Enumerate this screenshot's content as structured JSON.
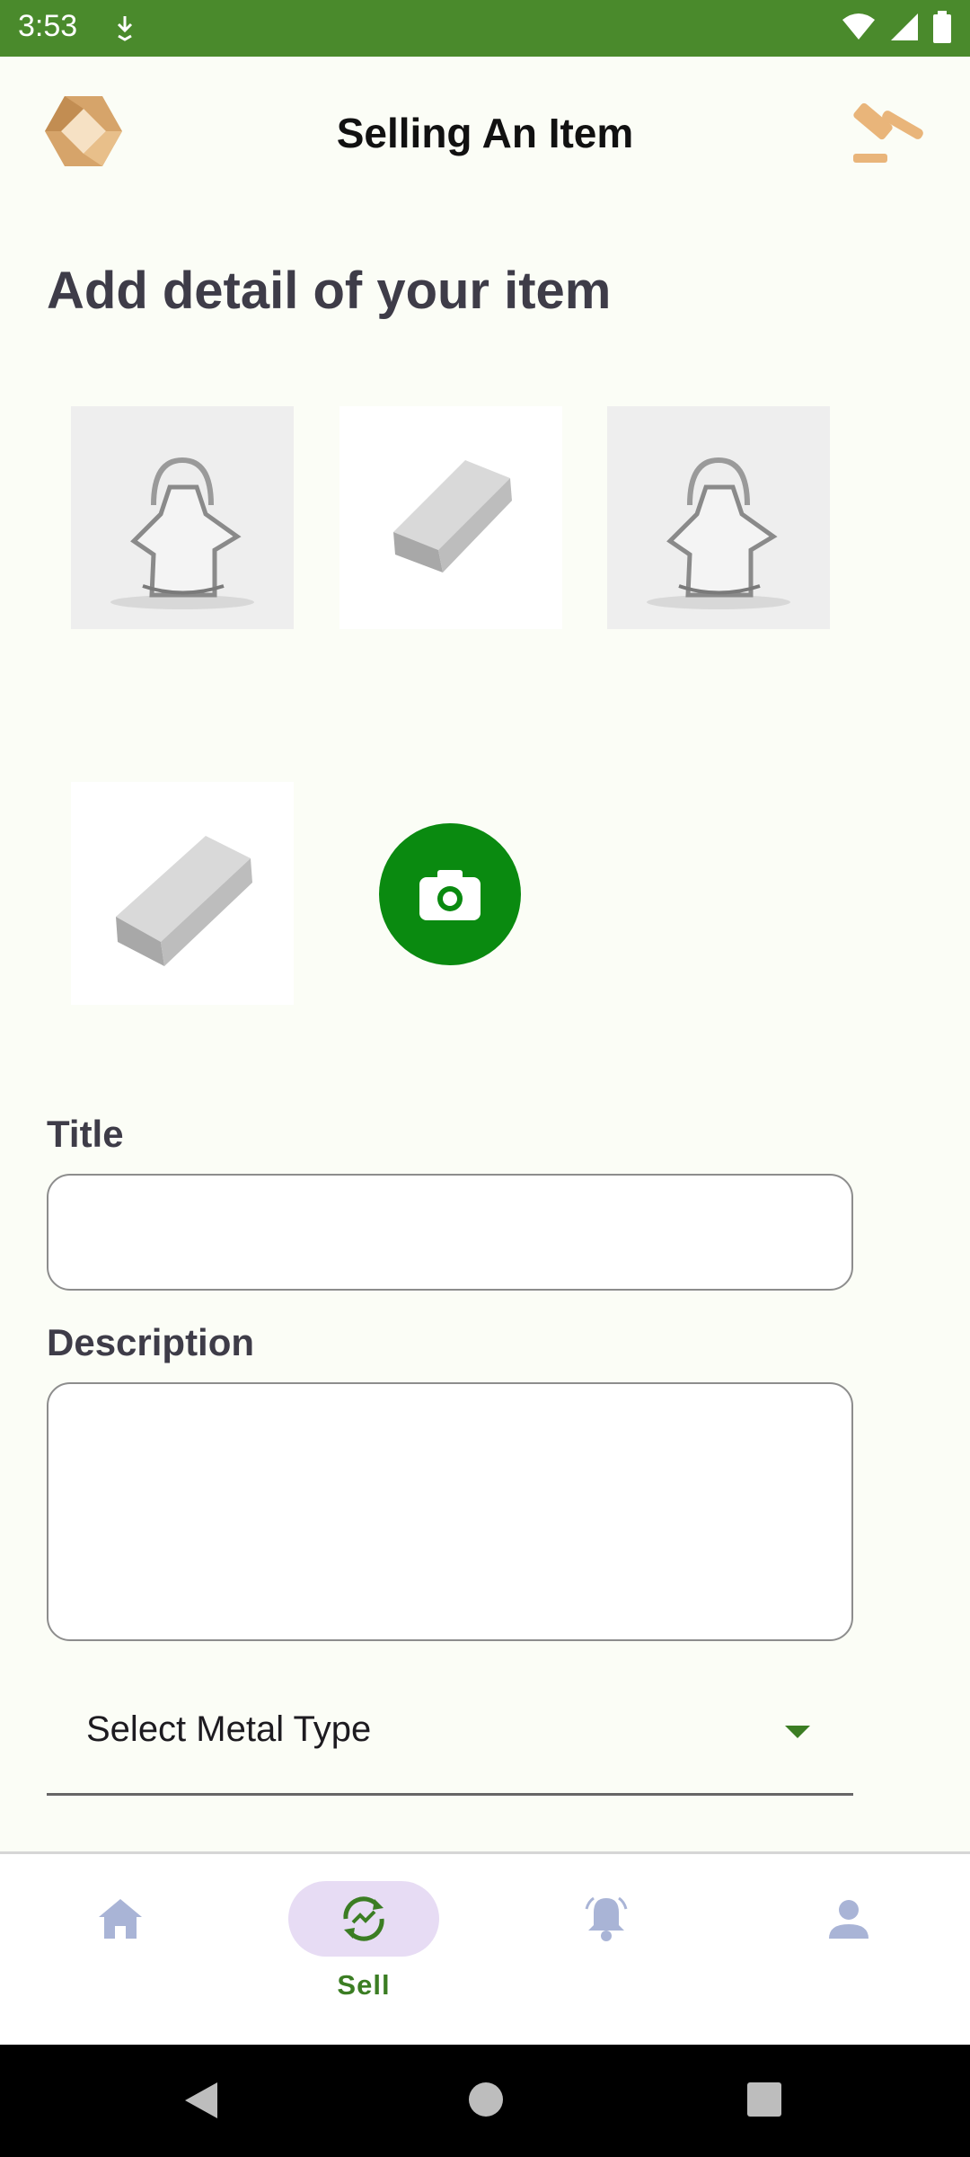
{
  "status_bar": {
    "time": "3:53"
  },
  "app_bar": {
    "title": "Selling An Item",
    "logo_icon": "app-logo-icon",
    "right_icon": "gavel-icon"
  },
  "section_title": "Add detail of your item",
  "photos": [
    {
      "name": "silver-keychain-photo"
    },
    {
      "name": "silver-bar-photo"
    },
    {
      "name": "silver-keychain-photo"
    },
    {
      "name": "silver-bar-photo"
    }
  ],
  "camera_button": {
    "icon": "camera-icon",
    "color": "#0a8a10"
  },
  "form": {
    "title_label": "Title",
    "title_value": "",
    "description_label": "Description",
    "description_value": "",
    "metal_select": {
      "value": "Select Metal Type"
    }
  },
  "bottom_nav": {
    "items": [
      {
        "icon": "home-icon",
        "label": ""
      },
      {
        "icon": "sell-icon",
        "label": "Sell",
        "active": true
      },
      {
        "icon": "bell-icon",
        "label": ""
      },
      {
        "icon": "person-icon",
        "label": ""
      }
    ],
    "accent": "#3b7d23",
    "inactive_icon_color": "#a9b4d6"
  }
}
